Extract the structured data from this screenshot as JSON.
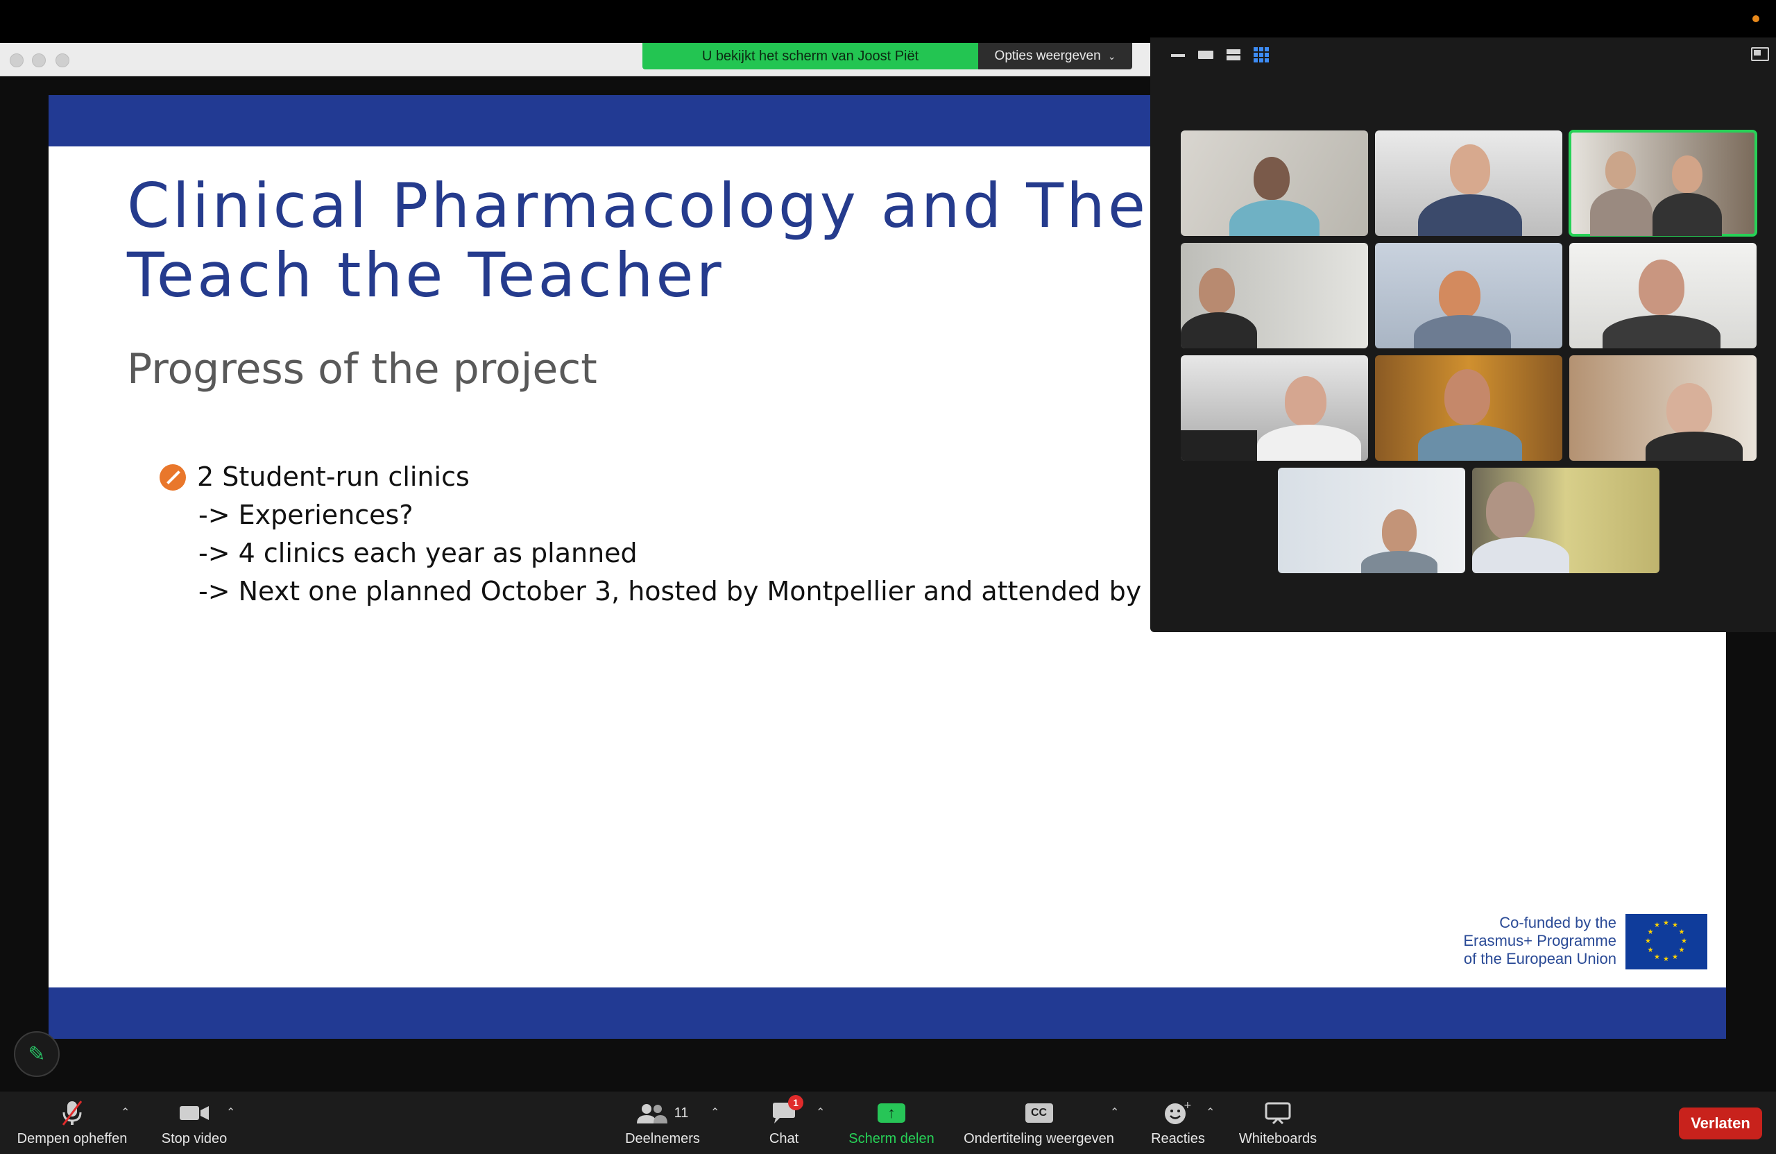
{
  "banner": {
    "viewing_text": "U bekijkt het scherm van Joost Piët",
    "view_options_label": "Opties weergeven"
  },
  "slide": {
    "title_line1": "Clinical Pharmacology and Ther",
    "title_line2": "Teach the Teacher",
    "subtitle": "Progress of the project",
    "bullet_main": "2 Student-run clinics",
    "sub_bullets": [
      "-> Experiences?",
      "-> 4 clinics each year as planned",
      "-> Next one planned October 3, hosted by Montpellier and attended by"
    ],
    "eu_text": [
      "Co-funded by the",
      "Erasmus+ Programme",
      "of the European Union"
    ],
    "colors": {
      "band": "#223a93",
      "title": "#253b8d",
      "bullet": "#e9772b"
    }
  },
  "gallery": {
    "view_icons": [
      "minimize-icon",
      "speaker-view-icon",
      "strip-view-icon",
      "gallery-grid-icon"
    ],
    "participant_count": 11
  },
  "toolbar": {
    "mute_label": "Dempen opheffen",
    "video_label": "Stop video",
    "participants_label": "Deelnemers",
    "participants_count": "11",
    "chat_label": "Chat",
    "chat_badge": "1",
    "share_label": "Scherm delen",
    "cc_label": "Ondertiteling weergeven",
    "cc_icon_text": "CC",
    "reactions_label": "Reacties",
    "whiteboards_label": "Whiteboards",
    "leave_label": "Verlaten"
  }
}
